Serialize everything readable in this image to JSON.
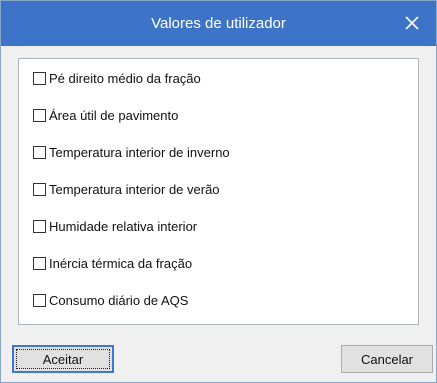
{
  "dialog": {
    "title": "Valores de utilizador",
    "close_icon": "close-icon",
    "titlebar_color": "#3e74c8"
  },
  "items": [
    {
      "label": "Pé direito médio da fração",
      "checked": false
    },
    {
      "label": "Área útil de pavimento",
      "checked": false
    },
    {
      "label": "Temperatura interior de inverno",
      "checked": false
    },
    {
      "label": "Temperatura interior de verão",
      "checked": false
    },
    {
      "label": "Humidade relativa interior",
      "checked": false
    },
    {
      "label": "Inércia térmica da fração",
      "checked": false
    },
    {
      "label": "Consumo diário de AQS",
      "checked": false
    }
  ],
  "buttons": {
    "accept_label": "Aceitar",
    "cancel_label": "Cancelar"
  }
}
